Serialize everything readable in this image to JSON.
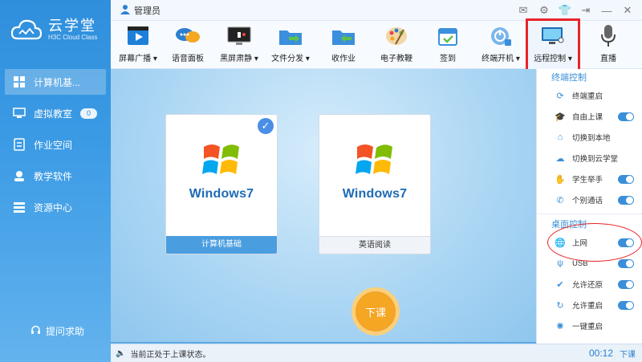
{
  "app": {
    "title": "云学堂",
    "subtitle": "H3C Cloud Class",
    "user": "管理员"
  },
  "sidebar": {
    "items": [
      {
        "label": "计算机基...",
        "icon": "grid-icon",
        "active": true
      },
      {
        "label": "虚拟教室",
        "icon": "virtual-classroom-icon",
        "badge": "0"
      },
      {
        "label": "作业空间",
        "icon": "homework-icon"
      },
      {
        "label": "教学软件",
        "icon": "software-icon"
      },
      {
        "label": "资源中心",
        "icon": "resource-icon"
      }
    ],
    "help": "提问求助"
  },
  "toolbar": {
    "tools": [
      {
        "label": "屏幕广播",
        "dropdown": true
      },
      {
        "label": "语音面板"
      },
      {
        "label": "黑屏肃静",
        "dropdown": true
      },
      {
        "label": "文件分发",
        "dropdown": true
      },
      {
        "label": "收作业"
      },
      {
        "label": "电子教鞭"
      },
      {
        "label": "签到"
      },
      {
        "label": "终端开机",
        "dropdown": true
      },
      {
        "label": "远程控制",
        "dropdown": true
      },
      {
        "label": "直播"
      }
    ]
  },
  "cards": [
    {
      "os": "Windows7",
      "caption": "计算机基础",
      "selected": true
    },
    {
      "os": "Windows7",
      "caption": "英语阅读",
      "selected": false
    }
  ],
  "end_class_label": "下课",
  "status": {
    "text": "当前正处于上课状态。",
    "timer": "00:12",
    "end": "下课"
  },
  "panel": {
    "terminal_title": "终端控制",
    "terminal_items": [
      "终端重启",
      "自由上课",
      "切换到本地",
      "切换到云学堂",
      "学生举手",
      "个别通话"
    ],
    "desktop_title": "桌面控制",
    "desktop_items": [
      "上网",
      "USB",
      "允许还原",
      "允许重启",
      "一键重启"
    ]
  },
  "colors": {
    "accent": "#3a8fd8",
    "highlight": "#e8232a",
    "end_button": "#f5a623"
  }
}
